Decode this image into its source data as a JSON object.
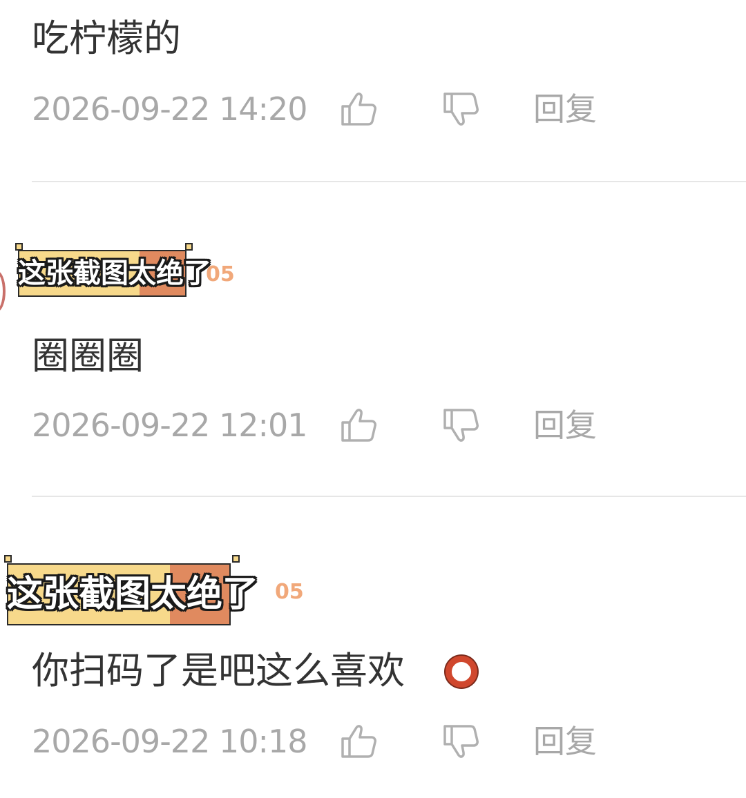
{
  "comments": [
    {
      "text": "吃柠檬的",
      "timestamp": "2026-09-22 14:20",
      "reply_label": "回复"
    },
    {
      "text": "圈圈圈",
      "timestamp": "2026-09-22 12:01",
      "reply_label": "回复"
    },
    {
      "text": "你扫码了是吧这么喜欢",
      "timestamp": "2026-09-22 10:18",
      "reply_label": "回复"
    }
  ],
  "stickers": [
    {
      "text": "这张截图太绝了"
    },
    {
      "text": "这张截图太绝了"
    }
  ],
  "username_fragments": [
    "05",
    "05"
  ],
  "icons": {
    "like": "thumbs-up-icon",
    "dislike": "thumbs-down-icon",
    "emoji": "red-circle-emoji-icon"
  },
  "colors": {
    "meta_text": "#a8a8a8",
    "comment_text": "#333333",
    "sticker_yellow": "#f7d98b",
    "sticker_orange": "#e08a5f"
  }
}
